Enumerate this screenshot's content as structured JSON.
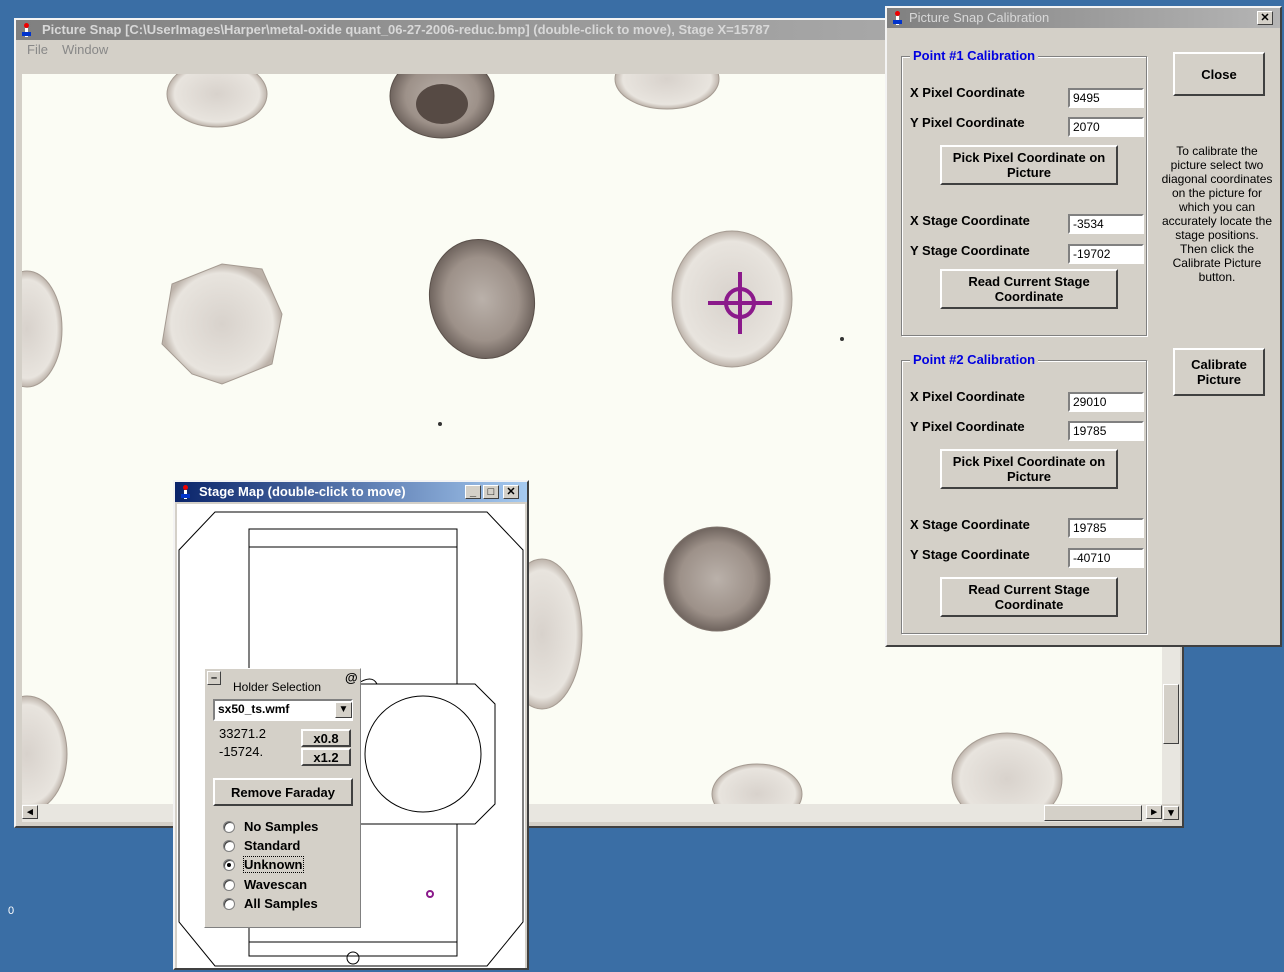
{
  "desktop": {
    "edge_digit": "0"
  },
  "main_window": {
    "title": "Picture Snap [C:\\UserImages\\Harper\\metal-oxide quant_06-27-2006-reduc.bmp] (double-click to move), Stage X=15787",
    "menu": [
      "File",
      "Window"
    ]
  },
  "stage_map": {
    "title": "Stage Map (double-click to move)",
    "at_symbol": "@",
    "holder_selection_label": "Holder Selection",
    "holder_value": "sx50_ts.wmf",
    "coord_x": "33271.2",
    "coord_y": "-15724.",
    "zoom_out_label": "x0.8",
    "zoom_in_label": "x1.2",
    "remove_faraday_label": "Remove Faraday",
    "sample_options": [
      "No Samples",
      "Standard",
      "Unknown",
      "Wavescan",
      "All Samples"
    ],
    "selected_option": "Unknown"
  },
  "calibration": {
    "title": "Picture Snap Calibration",
    "close_label": "Close",
    "calibrate_label": "Calibrate Picture",
    "instructions": "To calibrate the picture select two diagonal coordinates on the picture for which you can accurately locate the stage positions. Then click the Calibrate Picture button.",
    "point1": {
      "title": "Point #1 Calibration",
      "x_pixel_label": "X Pixel Coordinate",
      "x_pixel": "9495",
      "y_pixel_label": "Y Pixel Coordinate",
      "y_pixel": "2070",
      "pick_label": "Pick Pixel Coordinate on Picture",
      "x_stage_label": "X Stage Coordinate",
      "x_stage": "-3534",
      "y_stage_label": "Y Stage Coordinate",
      "y_stage": "-19702",
      "read_label": "Read Current Stage Coordinate"
    },
    "point2": {
      "title": "Point #2 Calibration",
      "x_pixel_label": "X Pixel Coordinate",
      "x_pixel": "29010",
      "y_pixel_label": "Y Pixel Coordinate",
      "y_pixel": "19785",
      "pick_label": "Pick Pixel Coordinate on Picture",
      "x_stage_label": "X Stage Coordinate",
      "x_stage": "19785",
      "y_stage_label": "Y Stage Coordinate",
      "y_stage": "-40710",
      "read_label": "Read Current Stage Coordinate"
    }
  },
  "colors": {
    "crosshair": "#8b1a8b",
    "desktop": "#3a6ea5",
    "group_title": "#0000e0"
  }
}
